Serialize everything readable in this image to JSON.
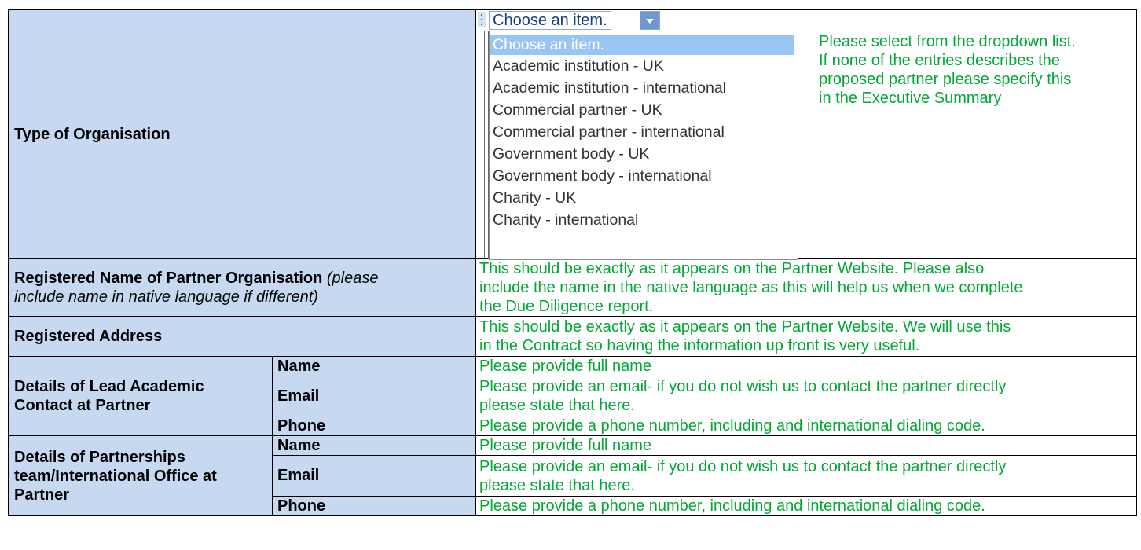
{
  "type_of_org": {
    "label": "Type of Organisation",
    "dropdown": {
      "current_value": "Choose an item.",
      "options": [
        "Choose an item.",
        "Academic institution - UK",
        "Academic institution - international",
        "Commercial partner - UK",
        "Commercial partner - international",
        "Government body - UK",
        "Government body - international",
        "Charity - UK",
        "Charity - international"
      ]
    },
    "note_lines": [
      "Please select from the dropdown list.",
      "If none of the entries describes the",
      "proposed partner please specify this",
      "in the Executive Summary"
    ]
  },
  "registered_name": {
    "label_bold": "Registered Name of Partner Organisation",
    "label_italic_1": "(please",
    "label_italic_2": "include name in native language if different)",
    "guide_lines": [
      "This should be exactly as it appears on the Partner Website. Please also",
      "include the name in the native language as this will help us when we complete",
      "the Due Diligence report."
    ]
  },
  "registered_address": {
    "label": "Registered Address",
    "guide_lines": [
      "This should be exactly as it appears on the Partner Website. We will use this",
      "in the Contract so having the information up front is very useful."
    ]
  },
  "lead_contact": {
    "label_lines": [
      "Details of Lead Academic",
      "Contact at Partner"
    ],
    "name_label": "Name",
    "name_guide": "Please provide full name",
    "email_label": "Email",
    "email_guide_lines": [
      "Please provide an email- if you do not wish us to contact the partner directly",
      "please state that here."
    ],
    "phone_label": "Phone",
    "phone_guide": "Please provide a phone number, including and international dialing code."
  },
  "partnerships_contact": {
    "label_lines": [
      "Details of Partnerships",
      "team/International Office at",
      "Partner"
    ],
    "name_label": "Name",
    "name_guide": "Please provide full name",
    "email_label": "Email",
    "email_guide_lines": [
      "Please provide an email- if you do not wish us to contact the partner directly",
      "please state that here."
    ],
    "phone_label": "Phone",
    "phone_guide": "Please provide a phone number, including and international dialing code."
  },
  "colors": {
    "label_bg": "#c6d9f1",
    "guide_text": "#00a933",
    "selected_option": "#99c4f4"
  }
}
